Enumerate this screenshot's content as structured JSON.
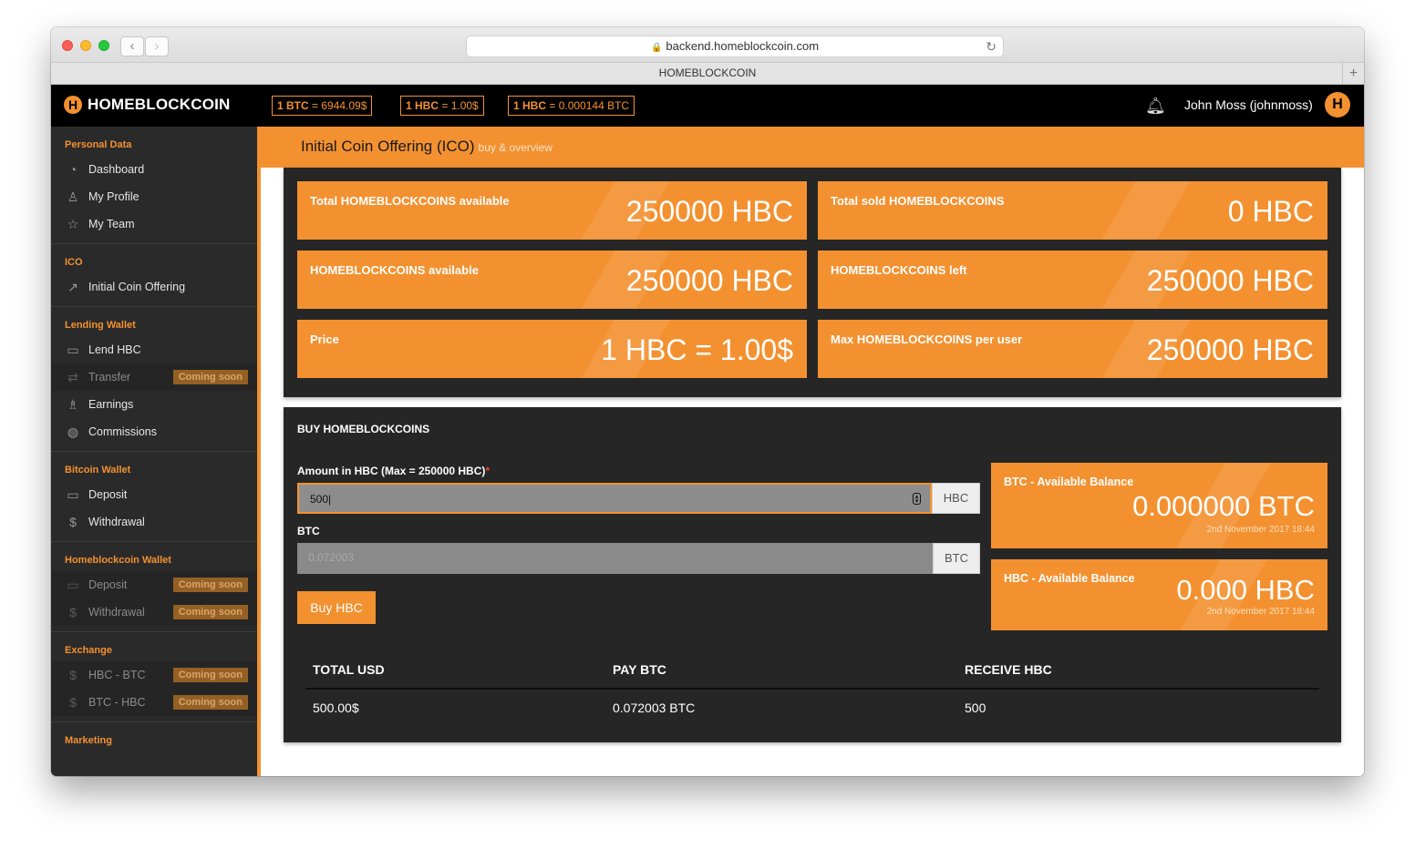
{
  "browser": {
    "url": "backend.homeblockcoin.com",
    "tab_title": "HOMEBLOCKCOIN"
  },
  "header": {
    "brand": "HOMEBLOCKCOIN",
    "rates": [
      {
        "label": "1 BTC",
        "value": " = 6944.09$"
      },
      {
        "label": "1 HBC",
        "value": " = 1.00$"
      },
      {
        "label": "1 HBC",
        "value": " = 0.000144 BTC"
      }
    ],
    "user": "John Moss (johnmoss)"
  },
  "sidebar": {
    "sections": [
      {
        "title": "Personal Data",
        "items": [
          {
            "label": "Dashboard",
            "icon": "dashboard-icon"
          },
          {
            "label": "My Profile",
            "icon": "user-icon"
          },
          {
            "label": "My Team",
            "icon": "star-icon"
          }
        ]
      },
      {
        "title": "ICO",
        "items": [
          {
            "label": "Initial Coin Offering",
            "icon": "share-icon"
          }
        ]
      },
      {
        "title": "Lending Wallet",
        "items": [
          {
            "label": "Lend HBC",
            "icon": "card-icon"
          },
          {
            "label": "Transfer",
            "icon": "transfer-icon",
            "badge": "Coming soon"
          },
          {
            "label": "Earnings",
            "icon": "rocket-icon"
          },
          {
            "label": "Commissions",
            "icon": "globe-icon"
          }
        ]
      },
      {
        "title": "Bitcoin Wallet",
        "items": [
          {
            "label": "Deposit",
            "icon": "card-icon"
          },
          {
            "label": "Withdrawal",
            "icon": "dollar-icon"
          }
        ]
      },
      {
        "title": "Homeblockcoin Wallet",
        "items": [
          {
            "label": "Deposit",
            "icon": "card-icon",
            "badge": "Coming soon"
          },
          {
            "label": "Withdrawal",
            "icon": "dollar-icon",
            "badge": "Coming soon"
          }
        ]
      },
      {
        "title": "Exchange",
        "items": [
          {
            "label": "HBC - BTC",
            "icon": "dollar-icon",
            "badge": "Coming soon"
          },
          {
            "label": "BTC - HBC",
            "icon": "dollar-icon",
            "badge": "Coming soon"
          }
        ]
      },
      {
        "title": "Marketing",
        "items": []
      }
    ]
  },
  "page": {
    "title": "Initial Coin Offering (ICO)",
    "subtitle": "buy & overview"
  },
  "stats": [
    {
      "label": "Total HOMEBLOCKCOINS available",
      "value": "250000 HBC"
    },
    {
      "label": "Total sold HOMEBLOCKCOINS",
      "value": "0 HBC"
    },
    {
      "label": "HOMEBLOCKCOINS available",
      "value": "250000 HBC"
    },
    {
      "label": "HOMEBLOCKCOINS left",
      "value": "250000 HBC"
    },
    {
      "label": "Price",
      "value": "1 HBC = 1.00$"
    },
    {
      "label": "Max HOMEBLOCKCOINS per user",
      "value": "250000 HBC"
    }
  ],
  "buy": {
    "title": "BUY HOMEBLOCKCOINS",
    "amount_label": "Amount in HBC (Max = 250000 HBC)",
    "required_mark": "*",
    "amount_value": "500",
    "amount_unit": "HBC",
    "btc_label": "BTC",
    "btc_value": "0.072003",
    "btc_unit": "BTC",
    "button": "Buy HBC",
    "balances": [
      {
        "label": "BTC - Available Balance",
        "value": "0.000000 BTC",
        "timestamp": "2nd November 2017 18:44"
      },
      {
        "label": "HBC - Available Balance",
        "value": "0.000 HBC",
        "timestamp": "2nd November 2017 18:44"
      }
    ],
    "table": {
      "headers": [
        "TOTAL USD",
        "PAY BTC",
        "RECEIVE HBC"
      ],
      "row": [
        "500.00$",
        "0.072003 BTC",
        "500"
      ]
    }
  }
}
